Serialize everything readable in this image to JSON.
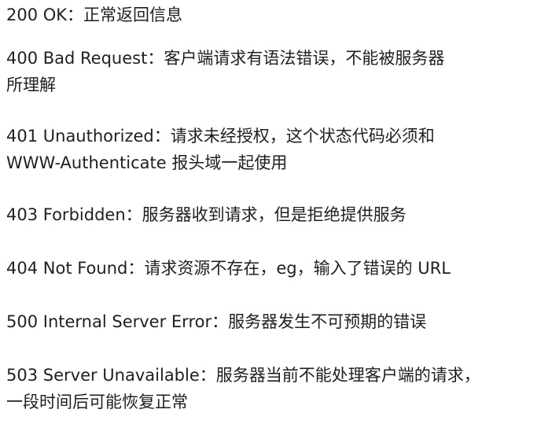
{
  "entries": [
    {
      "lines": [
        "200 OK：正常返回信息"
      ]
    },
    {
      "lines": [
        "400 Bad Request：客户端请求有语法错误，不能被服务器",
        "所理解"
      ]
    },
    {
      "lines": [
        "401 Unauthorized：请求未经授权，这个状态代码必须和",
        "WWW-Authenticate 报头域一起使用"
      ]
    },
    {
      "lines": [
        "403 Forbidden：服务器收到请求，但是拒绝提供服务"
      ]
    },
    {
      "lines": [
        "404 Not Found：请求资源不存在，eg，输入了错误的 URL"
      ]
    },
    {
      "lines": [
        "500 Internal Server Error：服务器发生不可预期的错误"
      ]
    },
    {
      "lines": [
        "503 Server Unavailable：服务器当前不能处理客户端的请求，",
        "一段时间后可能恢复正常"
      ]
    }
  ]
}
